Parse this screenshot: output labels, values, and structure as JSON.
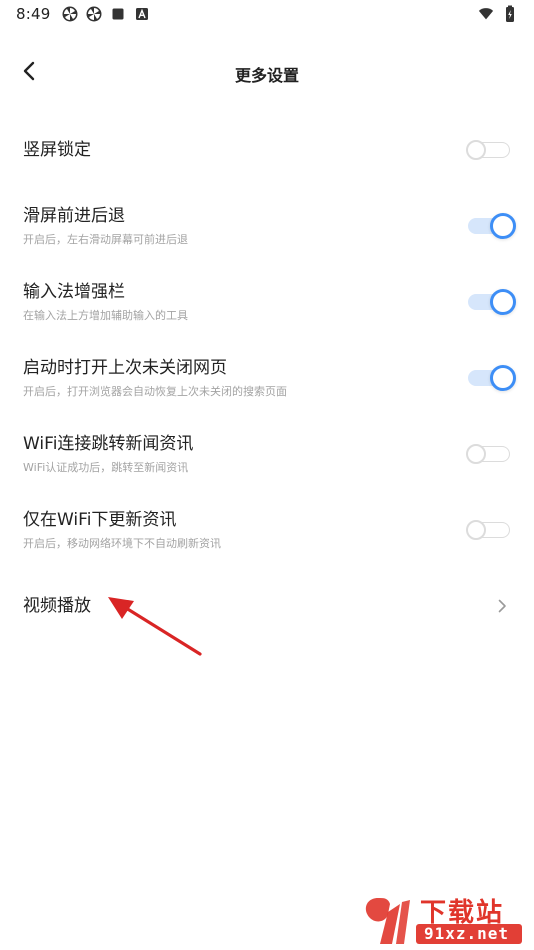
{
  "status_bar": {
    "time": "8:49",
    "left_icons": [
      "pinwheel-icon",
      "pinwheel-icon",
      "square-icon",
      "letter-a-icon"
    ],
    "right_icons": [
      "wifi-icon",
      "battery-charging-icon"
    ]
  },
  "header": {
    "title": "更多设置",
    "back_icon": "chevron-left-icon"
  },
  "settings": [
    {
      "title": "竖屏锁定",
      "desc": "",
      "control": "toggle",
      "on": false
    },
    {
      "title": "滑屏前进后退",
      "desc": "开启后，左右滑动屏幕可前进后退",
      "control": "toggle",
      "on": true
    },
    {
      "title": "输入法增强栏",
      "desc": "在输入法上方增加辅助输入的工具",
      "control": "toggle",
      "on": true
    },
    {
      "title": "启动时打开上次未关闭网页",
      "desc": "开启后，打开浏览器会自动恢复上次未关闭的搜索页面",
      "control": "toggle",
      "on": true
    },
    {
      "title": "WiFi连接跳转新闻资讯",
      "desc": "WiFi认证成功后，跳转至新闻资讯",
      "control": "toggle",
      "on": false
    },
    {
      "title": "仅在WiFi下更新资讯",
      "desc": "开启后，移动网络环境下不自动刷新资讯",
      "control": "toggle",
      "on": false
    },
    {
      "title": "视频播放",
      "desc": "",
      "control": "chevron"
    }
  ],
  "colors": {
    "accent": "#3d8ef6",
    "track_on": "#d6e6fb",
    "off_border": "#dcdcdc",
    "annotation": "#d92525",
    "watermark": "#e0352b"
  },
  "watermark": {
    "text_top": "下载站",
    "text_bottom": "91xz.net"
  }
}
